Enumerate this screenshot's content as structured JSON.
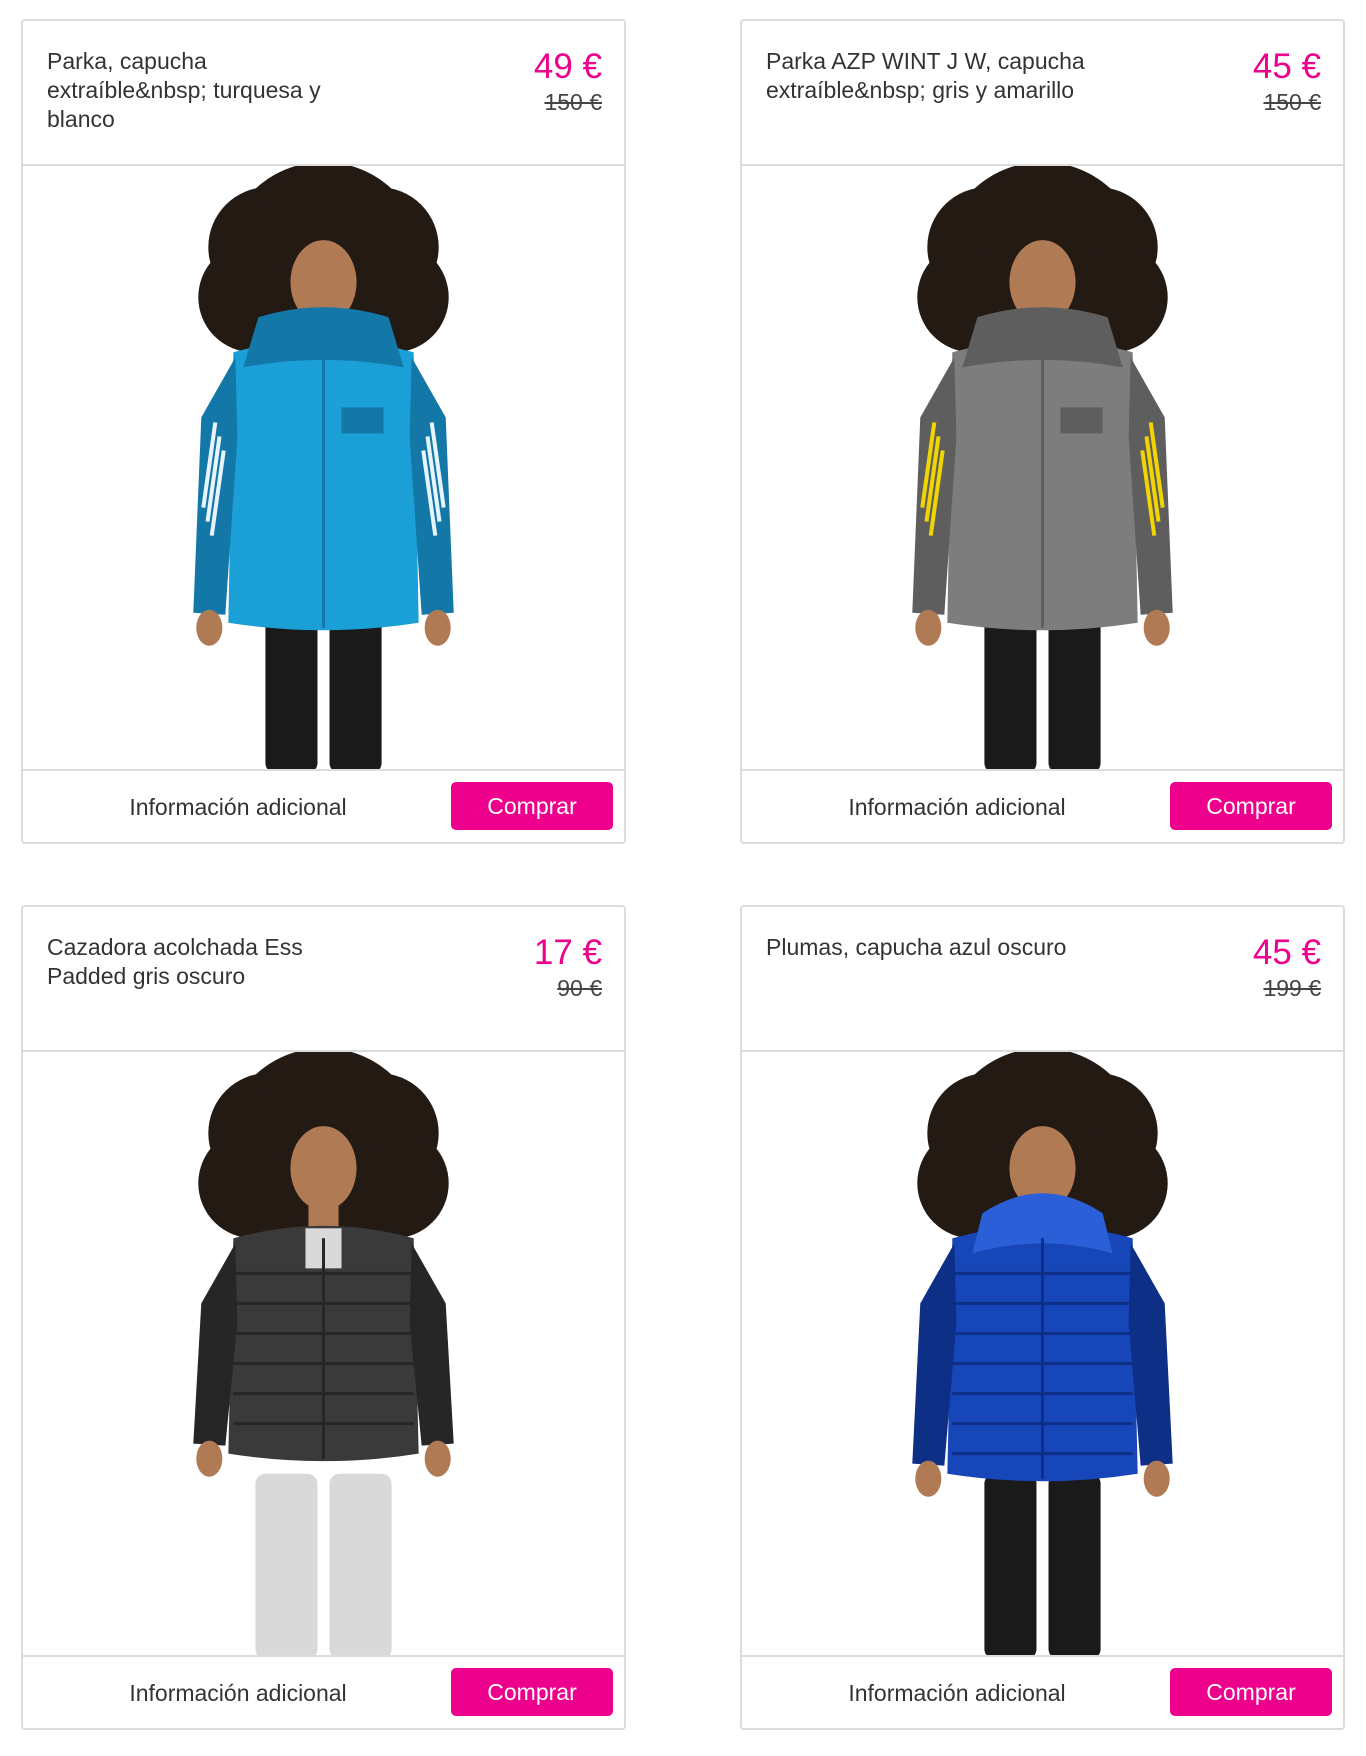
{
  "products": [
    {
      "title": "Parka, capucha extraíble&nbsp; turquesa y blanco",
      "price": "49 €",
      "old_price": "150 €",
      "info_label": "Información adicional",
      "buy_label": "Comprar",
      "colors": {
        "jacket": "#1a9fd6",
        "jacket_shade": "#1378a8",
        "stripe": "#e8f4fb",
        "pants": "#1a1a1a"
      },
      "style": "parka"
    },
    {
      "title": "Parka AZP WINT J W, capucha extraíble&nbsp; gris y amarillo",
      "price": "45 €",
      "old_price": "150 €",
      "info_label": "Información adicional",
      "buy_label": "Comprar",
      "colors": {
        "jacket": "#7d7d7d",
        "jacket_shade": "#5e5e5e",
        "stripe": "#f1d500",
        "pants": "#1a1a1a"
      },
      "style": "parka"
    },
    {
      "title": "Cazadora acolchada Ess Padded gris oscuro",
      "price": "17 €",
      "old_price": "90 €",
      "info_label": "Información adicional",
      "buy_label": "Comprar",
      "colors": {
        "jacket": "#3a3a3a",
        "jacket_shade": "#262626",
        "stripe": "#4a4a4a",
        "pants": "#d9d9d9"
      },
      "style": "puffer-short"
    },
    {
      "title": "Plumas, capucha azul oscuro",
      "price": "45 €",
      "old_price": "199 €",
      "info_label": "Información adicional",
      "buy_label": "Comprar",
      "colors": {
        "jacket": "#1746b8",
        "jacket_shade": "#0e2f86",
        "stripe": "#2a5fd8",
        "pants": "#1a1a1a"
      },
      "style": "puffer-hood"
    }
  ]
}
